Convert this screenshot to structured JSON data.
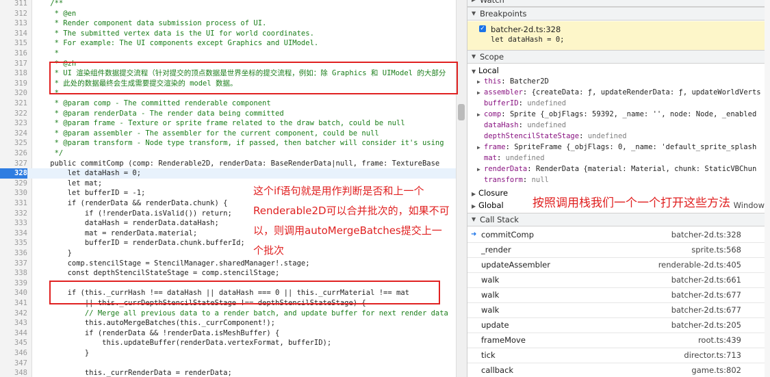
{
  "editor": {
    "lines": [
      {
        "n": "311",
        "t": "    /**",
        "c": "comment"
      },
      {
        "n": "312",
        "t": "     * @en",
        "c": "comment"
      },
      {
        "n": "313",
        "t": "     * Render component data submission process of UI.",
        "c": "comment"
      },
      {
        "n": "314",
        "t": "     * The submitted vertex data is the UI for world coordinates.",
        "c": "comment"
      },
      {
        "n": "315",
        "t": "     * For example: The UI components except Graphics and UIModel.",
        "c": "comment"
      },
      {
        "n": "316",
        "t": "     *",
        "c": "comment"
      },
      {
        "n": "317",
        "t": "     * @zh",
        "c": "comment"
      },
      {
        "n": "318",
        "t": "     * UI 渲染组件数据提交流程（针对提交的顶点数据是世界坐标的提交流程，例如：除 Graphics 和 UIModel 的大部分",
        "c": "comment"
      },
      {
        "n": "319",
        "t": "     * 此处的数据最终会生成需要提交渲染的 model 数据。",
        "c": "comment"
      },
      {
        "n": "320",
        "t": "     *",
        "c": "comment"
      },
      {
        "n": "321",
        "t": "     * @param comp - The committed renderable component",
        "c": "comment"
      },
      {
        "n": "322",
        "t": "     * @param renderData - The render data being committed",
        "c": "comment"
      },
      {
        "n": "323",
        "t": "     * @param frame - Texture or sprite frame related to the draw batch, could be null",
        "c": "comment"
      },
      {
        "n": "324",
        "t": "     * @param assembler - The assembler for the current component, could be null",
        "c": "comment"
      },
      {
        "n": "325",
        "t": "     * @param transform - Node type transform, if passed, then batcher will consider it's using",
        "c": "comment"
      },
      {
        "n": "326",
        "t": "     */",
        "c": "comment"
      },
      {
        "n": "327",
        "t": "    public commitComp (comp: Renderable2D, renderData: BaseRenderData|null, frame: TextureBase",
        "c": "plain"
      },
      {
        "n": "328",
        "t": "        let dataHash = 0;",
        "c": "plain"
      },
      {
        "n": "329",
        "t": "        let mat;",
        "c": "plain"
      },
      {
        "n": "330",
        "t": "        let bufferID = -1;",
        "c": "plain"
      },
      {
        "n": "331",
        "t": "        if (renderData && renderData.chunk) {",
        "c": "plain"
      },
      {
        "n": "332",
        "t": "            if (!renderData.isValid()) return;",
        "c": "plain"
      },
      {
        "n": "333",
        "t": "            dataHash = renderData.dataHash;",
        "c": "plain"
      },
      {
        "n": "334",
        "t": "            mat = renderData.material;",
        "c": "plain"
      },
      {
        "n": "335",
        "t": "            bufferID = renderData.chunk.bufferId;",
        "c": "plain"
      },
      {
        "n": "336",
        "t": "        }",
        "c": "plain"
      },
      {
        "n": "337",
        "t": "        comp.stencilStage = StencilManager.sharedManager!.stage;",
        "c": "plain"
      },
      {
        "n": "338",
        "t": "        const depthStencilStateStage = comp.stencilStage;",
        "c": "plain"
      },
      {
        "n": "339",
        "t": "",
        "c": "plain"
      },
      {
        "n": "340",
        "t": "        if (this._currHash !== dataHash || dataHash === 0 || this._currMaterial !== mat",
        "c": "plain"
      },
      {
        "n": "341",
        "t": "            || this._currDepthStencilStateStage !== depthStencilStateStage) {",
        "c": "plain"
      },
      {
        "n": "342",
        "t": "            // Merge all previous data to a render batch, and update buffer for next render data",
        "c": "comment"
      },
      {
        "n": "343",
        "t": "            this.autoMergeBatches(this._currComponent!);",
        "c": "plain"
      },
      {
        "n": "344",
        "t": "            if (renderData && !renderData.isMeshBuffer) {",
        "c": "plain"
      },
      {
        "n": "345",
        "t": "                this.updateBuffer(renderData.vertexFormat, bufferID);",
        "c": "plain"
      },
      {
        "n": "346",
        "t": "            }",
        "c": "plain"
      },
      {
        "n": "347",
        "t": "",
        "c": "plain"
      },
      {
        "n": "348",
        "t": "            this._currRenderData = renderData;",
        "c": "plain"
      }
    ]
  },
  "annotations": {
    "if_note": "这个if语句就是用作判断是否和上一个Renderable2D可以合并批次的，如果不可以，则调用autoMergeBatches提交上一个批次",
    "stack_note": "按照调用栈我们一个一个打开这些方法"
  },
  "debugger": {
    "watch_label": "Watch",
    "breakpoints_label": "Breakpoints",
    "breakpoint": {
      "file": "batcher-2d.ts:328",
      "code": "let dataHash = 0;"
    },
    "scope_label": "Scope",
    "local_label": "Local",
    "scope_rows": [
      {
        "tri": "▶",
        "prop": "this",
        "val": "Batcher2D",
        "cls": "val"
      },
      {
        "tri": "▶",
        "prop": "assembler",
        "val": "{createData: ƒ, updateRenderData: ƒ, updateWorldVerts",
        "cls": "val"
      },
      {
        "tri": "",
        "prop": "bufferID",
        "val": "undefined",
        "cls": "val-gray"
      },
      {
        "tri": "▶",
        "prop": "comp",
        "val": "Sprite {_objFlags: 59392, _name: '', node: Node, _enabled",
        "cls": "val"
      },
      {
        "tri": "",
        "prop": "dataHash",
        "val": "undefined",
        "cls": "val-gray"
      },
      {
        "tri": "",
        "prop": "depthStencilStateStage",
        "val": "undefined",
        "cls": "val-gray"
      },
      {
        "tri": "▶",
        "prop": "frame",
        "val": "SpriteFrame {_objFlags: 0, _name: 'default_sprite_splash",
        "cls": "val"
      },
      {
        "tri": "",
        "prop": "mat",
        "val": "undefined",
        "cls": "val-gray"
      },
      {
        "tri": "▶",
        "prop": "renderData",
        "val": "RenderData {material: Material, chunk: StaticVBChun",
        "cls": "val"
      },
      {
        "tri": "",
        "prop": "transform",
        "val": "null",
        "cls": "val-gray"
      }
    ],
    "closure_label": "Closure",
    "global_label": "Global",
    "global_value": "Window",
    "callstack_label": "Call Stack",
    "callstack": [
      {
        "fn": "commitComp",
        "loc": "batcher-2d.ts:328"
      },
      {
        "fn": "_render",
        "loc": "sprite.ts:568"
      },
      {
        "fn": "updateAssembler",
        "loc": "renderable-2d.ts:405"
      },
      {
        "fn": "walk",
        "loc": "batcher-2d.ts:661"
      },
      {
        "fn": "walk",
        "loc": "batcher-2d.ts:677"
      },
      {
        "fn": "walk",
        "loc": "batcher-2d.ts:677"
      },
      {
        "fn": "update",
        "loc": "batcher-2d.ts:205"
      },
      {
        "fn": "frameMove",
        "loc": "root.ts:439"
      },
      {
        "fn": "tick",
        "loc": "director.ts:713"
      },
      {
        "fn": "callback",
        "loc": "game.ts:802"
      }
    ]
  }
}
